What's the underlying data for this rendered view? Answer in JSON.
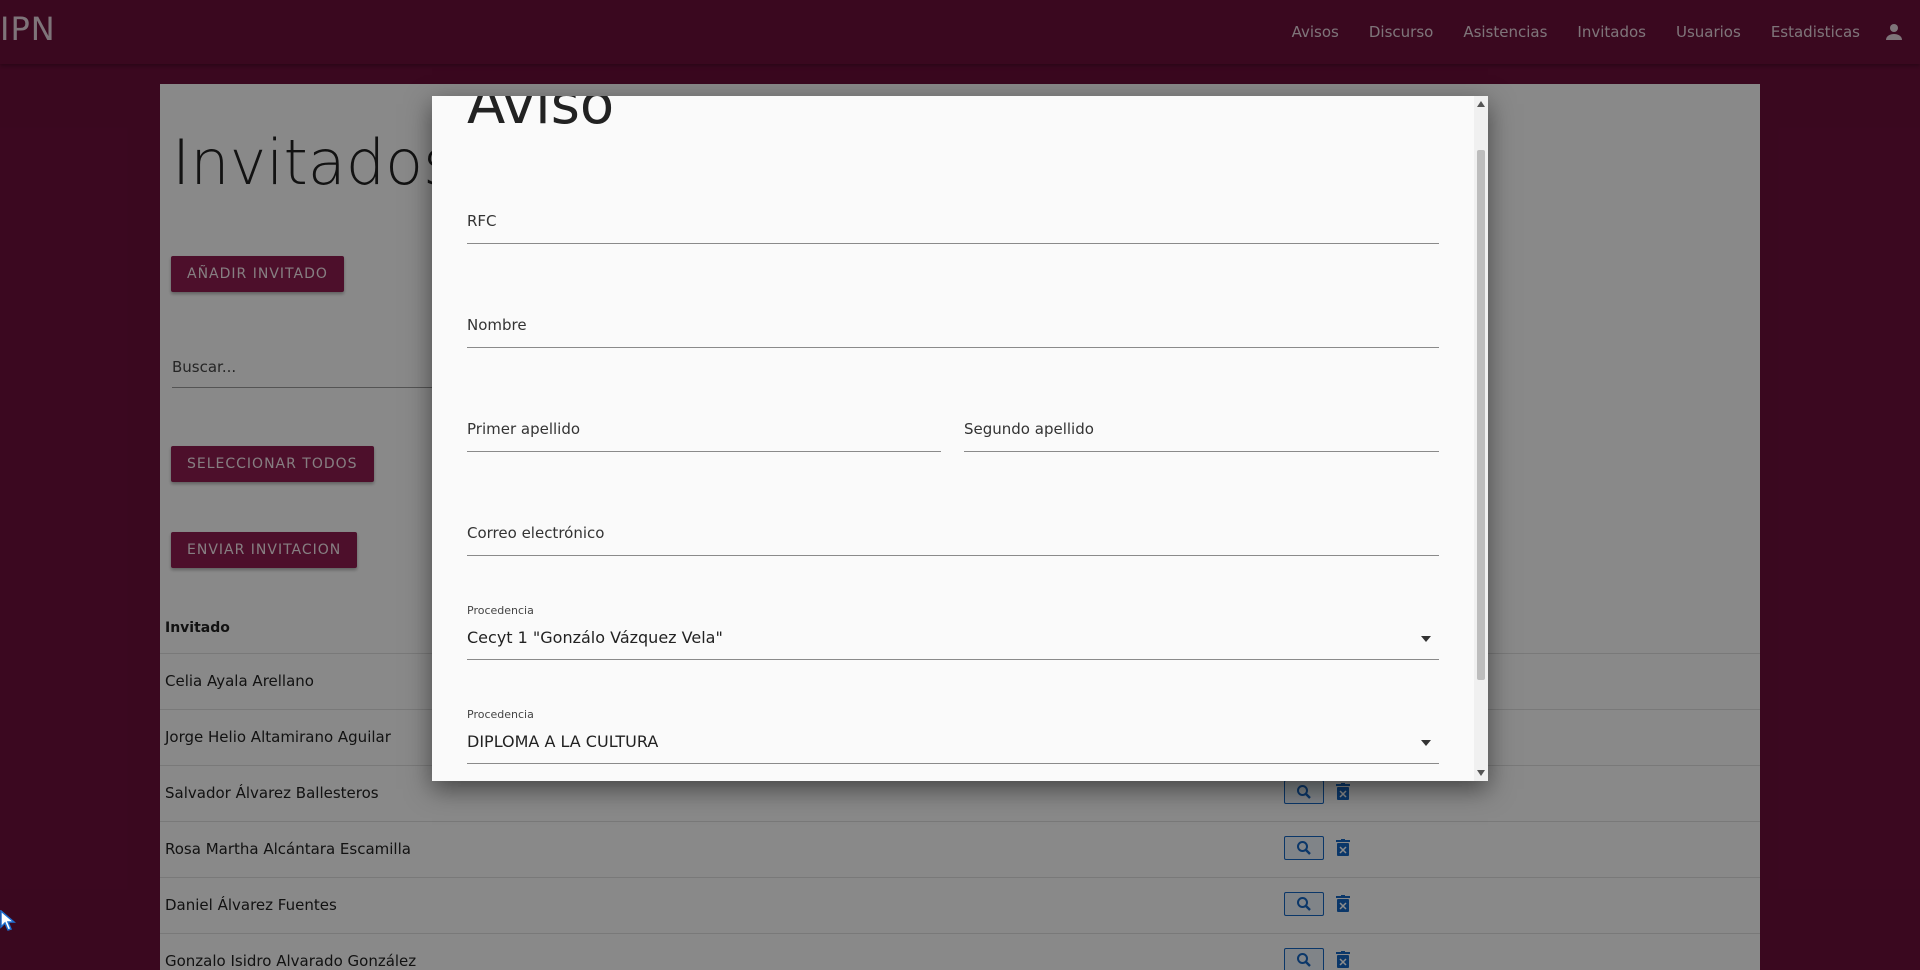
{
  "app": {
    "brand": "IPN"
  },
  "nav": [
    "Avisos",
    "Discurso",
    "Asistencias",
    "Invitados",
    "Usuarios",
    "Estadisticas"
  ],
  "page": {
    "title": "Invitados",
    "add_button": "AÑADIR INVITADO",
    "search_placeholder": "Buscar...",
    "select_all_button": "SELECCIONAR TODOS",
    "send_button": "ENVIAR INVITACION",
    "table": {
      "header": "Invitado",
      "rows": [
        "Celia Ayala Arellano",
        "Jorge Helio Altamirano Aguilar",
        "Salvador Álvarez Ballesteros",
        "Rosa Martha Alcántara Escamilla",
        "Daniel Álvarez Fuentes",
        "Gonzalo Isidro Alvarado González"
      ]
    }
  },
  "modal": {
    "title": "Aviso",
    "fields": {
      "rfc": "RFC",
      "nombre": "Nombre",
      "primer_apellido": "Primer apellido",
      "segundo_apellido": "Segundo apellido",
      "correo": "Correo electrónico",
      "procedencia_label": "Procedencia",
      "procedencia_value": "Cecyt 1 \"Gonzálo Vázquez Vela\"",
      "procedencia2_label": "Procedencia",
      "procedencia2_value": "DIPLOMA A LA CULTURA"
    }
  },
  "colors": {
    "brand": "#6b0f3a",
    "button": "#8c1d4f",
    "action": "#1565c0"
  }
}
